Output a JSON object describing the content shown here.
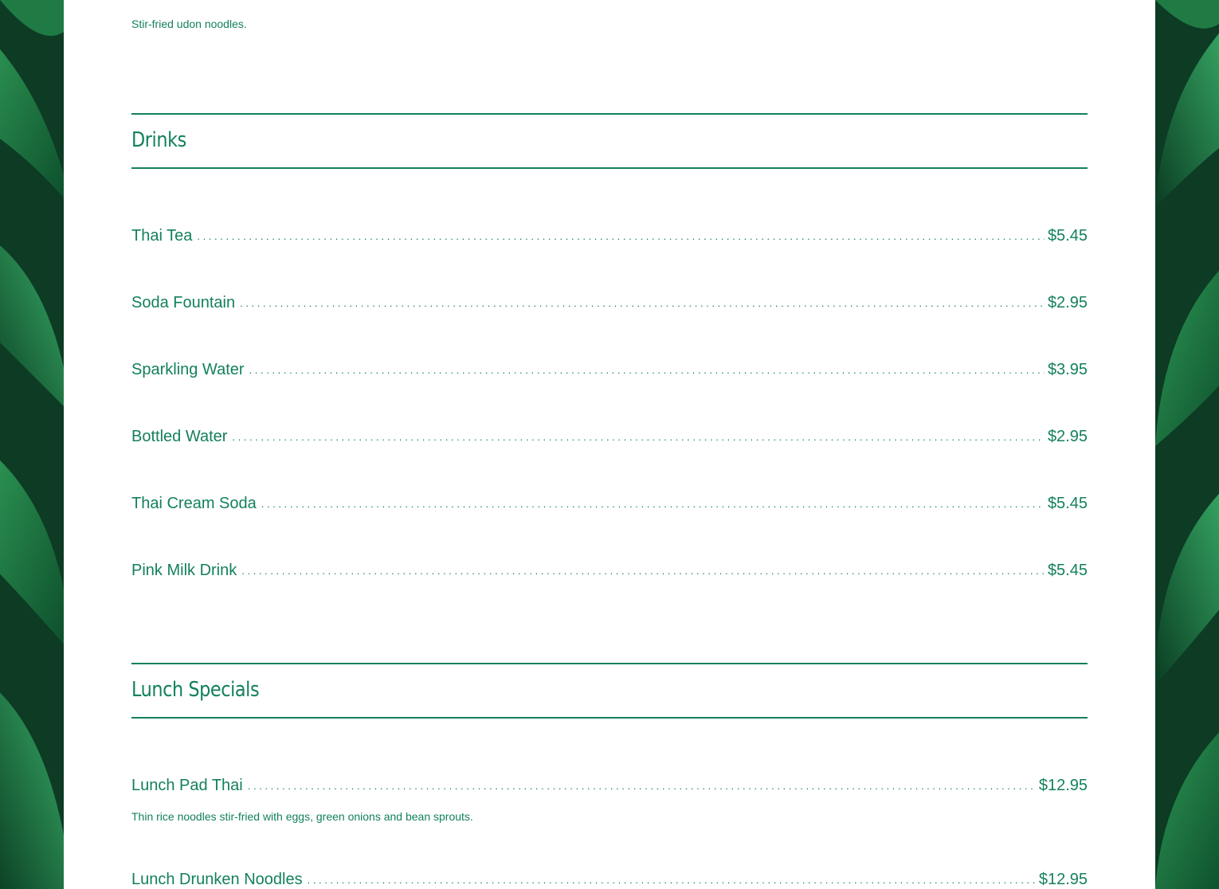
{
  "theme": {
    "accent_color": "#13805d",
    "panel_color": "#ffffff",
    "background_color": "#0e3a25"
  },
  "top_item": {
    "description": "Stir-fried udon noodles."
  },
  "sections": {
    "drinks": {
      "title": "Drinks",
      "items": [
        {
          "name": "Thai Tea",
          "price": "$5.45"
        },
        {
          "name": "Soda Fountain",
          "price": "$2.95"
        },
        {
          "name": "Sparkling Water",
          "price": "$3.95"
        },
        {
          "name": "Bottled Water",
          "price": "$2.95"
        },
        {
          "name": "Thai Cream Soda",
          "price": "$5.45"
        },
        {
          "name": "Pink Milk Drink",
          "price": "$5.45"
        }
      ]
    },
    "lunch": {
      "title": "Lunch Specials",
      "items": [
        {
          "name": "Lunch Pad Thai",
          "price": "$12.95",
          "description": "Thin rice noodles stir-fried with eggs, green onions and bean sprouts."
        },
        {
          "name": "Lunch Drunken Noodles",
          "price": "$12.95"
        }
      ]
    }
  }
}
